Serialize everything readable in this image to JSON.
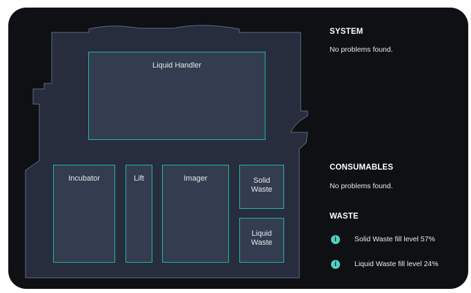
{
  "layout": {
    "modules": {
      "liquid_handler": "Liquid Handler",
      "incubator": "Incubator",
      "lift": "Lift",
      "imager": "Imager",
      "solid_waste": [
        "Solid",
        "Waste"
      ],
      "liquid_waste": [
        "Liquid",
        "Waste"
      ]
    }
  },
  "status": {
    "system": {
      "title": "SYSTEM",
      "message": "No problems found."
    },
    "consumables": {
      "title": "CONSUMABLES",
      "message": "No problems found."
    },
    "waste": {
      "title": "WASTE",
      "items": [
        {
          "icon": "info-icon",
          "text": "Solid Waste fill level 57%"
        },
        {
          "icon": "info-icon",
          "text": "Liquid Waste fill level 24%"
        }
      ]
    }
  },
  "colors": {
    "panel_bg": "#0e1014",
    "floor_fill": "#272d3c",
    "module_fill": "#343c4f",
    "module_border": "#1fb8a3",
    "info_icon": "#4fd3c1"
  }
}
